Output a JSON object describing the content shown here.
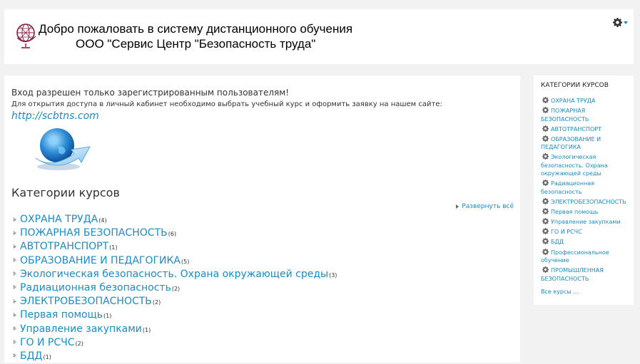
{
  "header": {
    "title_line1": "Добро пожаловать в систему дистанционного обучения",
    "title_line2": "ООО \"Сервис Центр \"Безопасность труда\""
  },
  "main": {
    "login_message": "Вход разрешен только зарегистрированным пользователям!",
    "access_message": "Для открытия доступа в личный кабинет необходимо выбрать учебный курс и оформить заявку на нашем сайте:",
    "site_link": "http://scbtns.com",
    "categories_heading": "Категории курсов",
    "expand_all": "Развернуть всё",
    "categories": [
      {
        "name": "ОХРАНА ТРУДА",
        "count": "(4)"
      },
      {
        "name": "ПОЖАРНАЯ БЕЗОПАСНОСТЬ",
        "count": "(6)"
      },
      {
        "name": "АВТОТРАНСПОРТ",
        "count": "(1)"
      },
      {
        "name": "ОБРАЗОВАНИЕ И ПЕДАГОГИКА",
        "count": "(5)"
      },
      {
        "name": "Экологическая безопасность. Охрана окружающей среды",
        "count": "(3)"
      },
      {
        "name": "Радиационная безопасность",
        "count": "(2)"
      },
      {
        "name": "ЭЛЕКТРОБЕЗОПАСНОСТЬ",
        "count": "(2)"
      },
      {
        "name": "Первая помощь",
        "count": "(1)"
      },
      {
        "name": "Управление закупками",
        "count": "(1)"
      },
      {
        "name": "ГО И РСЧС",
        "count": "(2)"
      },
      {
        "name": "БДД",
        "count": "(1)"
      }
    ]
  },
  "sidebar": {
    "title": "КАТЕГОРИИ КУРСОВ",
    "items": [
      "ОХРАНА ТРУДА",
      "ПОЖАРНАЯ БЕЗОПАСНОСТЬ",
      "АВТОТРАНСПОРТ",
      "ОБРАЗОВАНИЕ И ПЕДАГОГИКА",
      "Экологическая безопасность. Охрана окружающей среды",
      "Радиационная безопасность",
      "ЭЛЕКТРОБЕЗОПАСНОСТЬ",
      "Первая помощь",
      "Управление закупками",
      "ГО И РСЧС",
      "БДД",
      "Профессиональное обучение",
      "ПРОМЫШЛЕННАЯ БЕЗОПАСНОСТЬ"
    ],
    "all_courses": "Все курсы ..."
  },
  "icons": {
    "logo": "globe-logo-icon",
    "gear": "gear-icon",
    "caret": "caret-down-icon",
    "category": "category-gear-icon",
    "expand": "triangle-right-icon",
    "globe_image": "globe-arrow-icon"
  },
  "colors": {
    "link": "#1a8cc7",
    "background": "#f2f2f2",
    "panel": "#ffffff",
    "logo": "#8a2040"
  }
}
